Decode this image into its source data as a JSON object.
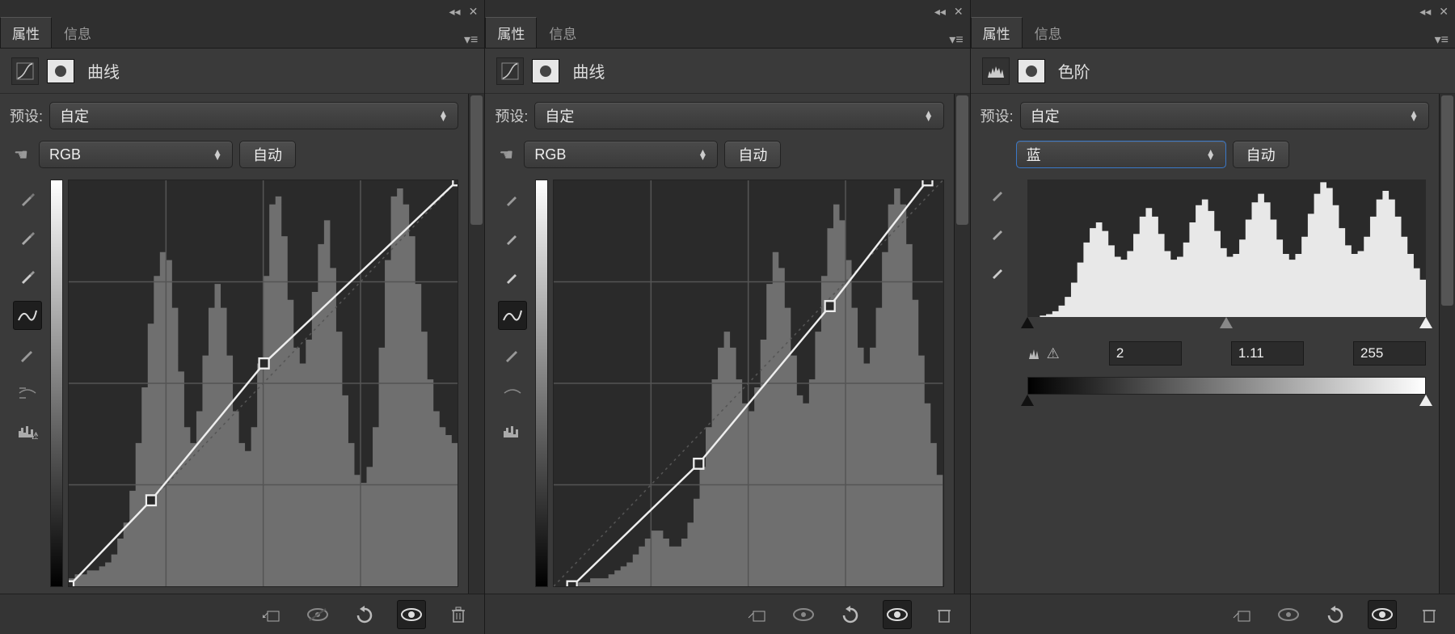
{
  "tabs": {
    "properties": "属性",
    "info": "信息"
  },
  "common": {
    "preset_label": "预设:",
    "preset_value": "自定",
    "auto": "自动",
    "channel_rgb": "RGB",
    "channel_blue": "蓝"
  },
  "panel1": {
    "title": "曲线"
  },
  "panel2": {
    "title": "曲线"
  },
  "panel3": {
    "title": "色阶",
    "input_black": "2",
    "input_gamma": "1.11",
    "input_white": "255"
  },
  "chart_data": [
    {
      "type": "line",
      "title": "曲线 RGB",
      "xlim": [
        0,
        255
      ],
      "ylim": [
        0,
        255
      ],
      "points": [
        [
          0,
          0
        ],
        [
          54,
          54
        ],
        [
          128,
          140
        ],
        [
          255,
          255
        ]
      ],
      "histogram": [
        2,
        3,
        3,
        4,
        4,
        5,
        6,
        8,
        12,
        16,
        24,
        36,
        50,
        66,
        78,
        84,
        82,
        70,
        54,
        40,
        36,
        44,
        58,
        70,
        76,
        70,
        58,
        44,
        36,
        34,
        40,
        56,
        78,
        96,
        98,
        88,
        72,
        60,
        56,
        62,
        74,
        86,
        92,
        80,
        64,
        48,
        36,
        28,
        26,
        30,
        40,
        60,
        82,
        98,
        100,
        96,
        88,
        76,
        64,
        52,
        44,
        40,
        38,
        36
      ]
    },
    {
      "type": "line",
      "title": "曲线 RGB",
      "xlim": [
        0,
        255
      ],
      "ylim": [
        0,
        255
      ],
      "points": [
        [
          12,
          0
        ],
        [
          95,
          77
        ],
        [
          181,
          176
        ],
        [
          245,
          255
        ]
      ],
      "histogram": [
        0,
        0,
        0,
        0,
        1,
        1,
        2,
        2,
        2,
        3,
        4,
        5,
        6,
        8,
        10,
        12,
        14,
        14,
        12,
        10,
        10,
        12,
        16,
        22,
        30,
        40,
        52,
        60,
        64,
        60,
        52,
        46,
        44,
        50,
        62,
        76,
        84,
        80,
        70,
        58,
        48,
        46,
        52,
        64,
        78,
        90,
        96,
        92,
        82,
        70,
        60,
        56,
        60,
        70,
        84,
        96,
        100,
        96,
        86,
        72,
        58,
        46,
        36,
        28
      ]
    },
    {
      "type": "area",
      "title": "色阶 蓝",
      "xlim": [
        0,
        255
      ],
      "input_levels": [
        2,
        1.11,
        255
      ],
      "output_levels": [
        0,
        255
      ],
      "histogram": [
        0,
        0,
        1,
        2,
        4,
        8,
        14,
        24,
        38,
        52,
        62,
        66,
        60,
        50,
        42,
        40,
        46,
        58,
        70,
        76,
        70,
        58,
        46,
        40,
        42,
        52,
        66,
        78,
        82,
        74,
        60,
        48,
        42,
        44,
        54,
        68,
        80,
        86,
        80,
        68,
        54,
        44,
        40,
        44,
        56,
        72,
        86,
        94,
        90,
        78,
        62,
        50,
        44,
        46,
        56,
        70,
        82,
        88,
        82,
        70,
        56,
        44,
        34,
        26
      ]
    }
  ]
}
